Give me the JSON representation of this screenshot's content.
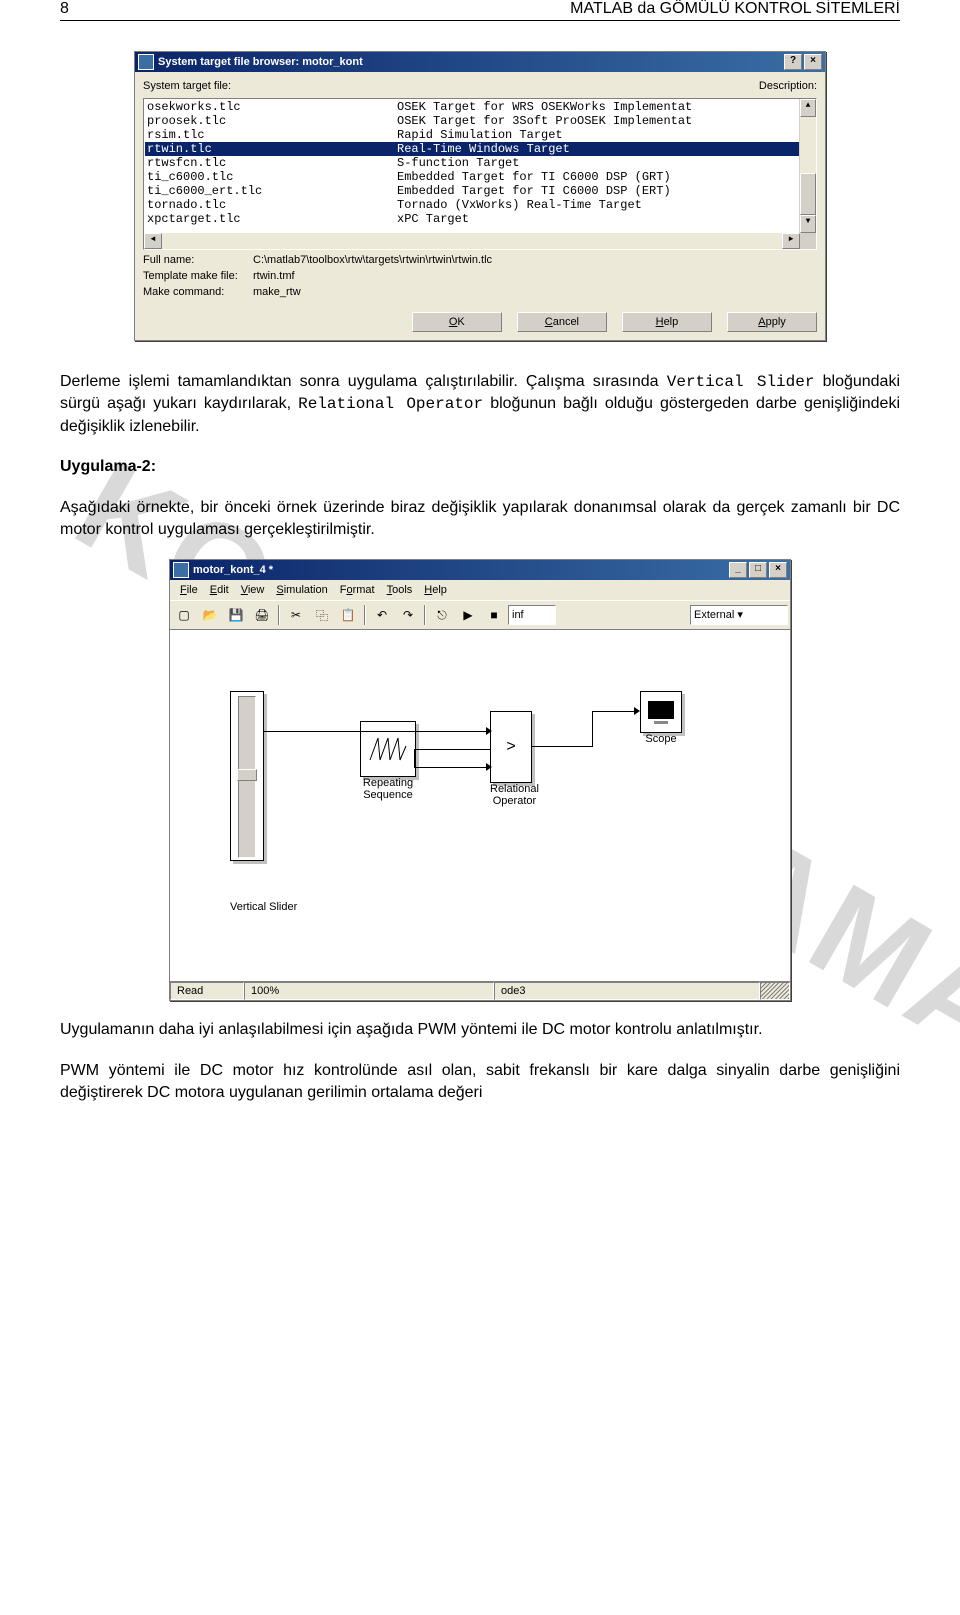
{
  "page": {
    "number": "8",
    "title": "MATLAB da GÖMÜLÜ KONTROL SİTEMLERİ"
  },
  "watermark": "KOPYALANAMAZ YTU ELM BLM",
  "dialog": {
    "title": "System target file browser: motor_kont",
    "label_file": "System target file:",
    "label_desc": "Description:",
    "rows": [
      {
        "file": "osekworks.tlc",
        "desc": "OSEK Target for WRS OSEKWorks Implementat"
      },
      {
        "file": "proosek.tlc",
        "desc": "OSEK Target for 3Soft ProOSEK Implementat"
      },
      {
        "file": "rsim.tlc",
        "desc": "Rapid Simulation Target"
      },
      {
        "file": "rtwin.tlc",
        "desc": "Real-Time Windows Target"
      },
      {
        "file": "rtwsfcn.tlc",
        "desc": "S-function Target"
      },
      {
        "file": "ti_c6000.tlc",
        "desc": "Embedded Target for TI C6000 DSP (GRT)"
      },
      {
        "file": "ti_c6000_ert.tlc",
        "desc": "Embedded Target for TI C6000 DSP (ERT)"
      },
      {
        "file": "tornado.tlc",
        "desc": "Tornado (VxWorks) Real-Time Target"
      },
      {
        "file": "xpctarget.tlc",
        "desc": "xPC Target"
      }
    ],
    "selected_index": 3,
    "fullname_label": "Full name:",
    "fullname_value": "C:\\matlab7\\toolbox\\rtw\\targets\\rtwin\\rtwin\\rtwin.tlc",
    "tmf_label": "Template make file:",
    "tmf_value": "rtwin.tmf",
    "make_label": "Make command:",
    "make_value": "make_rtw",
    "buttons": {
      "ok": "OK",
      "cancel": "Cancel",
      "help": "Help",
      "apply": "Apply"
    }
  },
  "paragraphs": {
    "p1a": "Derleme işlemi tamamlandıktan sonra uygulama çalıştırılabilir. Çalışma sırasında ",
    "p1_vs": "Vertical Slider",
    "p1b": " bloğundaki sürgü aşağı yukarı kaydırılarak, ",
    "p1_ro": "Relational Operator",
    "p1c": " bloğunun bağlı olduğu göstergeden darbe genişliğindeki değişiklik izlenebilir.",
    "h2": "Uygulama-2:",
    "p2": "Aşağıdaki örnekte, bir önceki örnek üzerinde biraz değişiklik yapılarak donanımsal olarak da gerçek zamanlı bir DC motor kontrol uygulaması gerçekleştirilmiştir.",
    "p3": "Uygulamanın daha iyi anlaşılabilmesi için aşağıda PWM yöntemi ile DC motor kontrolu anlatılmıştır.",
    "p4": "PWM yöntemi ile DC motor hız kontrolünde asıl olan, sabit frekanslı bir kare dalga sinyalin darbe genişliğini değiştirerek DC motora uygulanan gerilimin ortalama değeri"
  },
  "simulink": {
    "title": "motor_kont_4 *",
    "menus": [
      "File",
      "Edit",
      "View",
      "Simulation",
      "Format",
      "Tools",
      "Help"
    ],
    "stoptime": "inf",
    "mode": "External",
    "blocks": {
      "slider": "Vertical Slider",
      "repseq": "Repeating\nSequence",
      "relop": "Relational\nOperator",
      "relop_sym": ">",
      "scope": "Scope"
    },
    "status": {
      "ready": "Read",
      "pct": "100%",
      "solver": "ode3"
    }
  }
}
